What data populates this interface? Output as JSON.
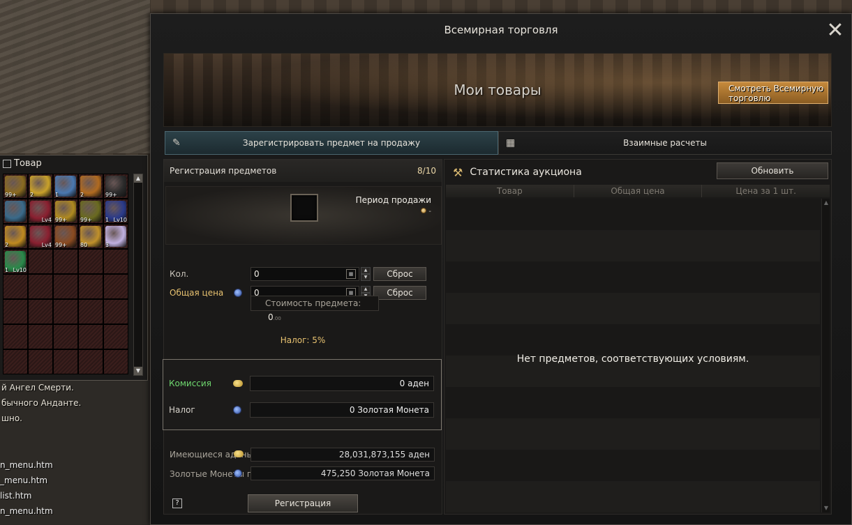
{
  "background": {
    "chat_lines": [
      "й Ангел Смерти.",
      "бычного Анданте.",
      "шно."
    ],
    "file_lines": [
      "n_menu.htm",
      "_menu.htm",
      "list.htm",
      "n_menu.htm"
    ]
  },
  "inventory": {
    "title": "Товар",
    "slots": [
      {
        "qty": "99+",
        "lv": "",
        "color": "#8a6a20"
      },
      {
        "qty": "2",
        "lv": "",
        "color": "#c9a12a"
      },
      {
        "qty": "1",
        "lv": "",
        "color": "#4a78b0"
      },
      {
        "qty": "2",
        "lv": "",
        "color": "#b06a20"
      },
      {
        "qty": "99+",
        "lv": "",
        "color": "#2a2a2a"
      },
      {
        "qty": "",
        "lv": "",
        "color": "#3a6a8a"
      },
      {
        "qty": "",
        "lv": "Lv4",
        "color": "#8a2030"
      },
      {
        "qty": "99+",
        "lv": "",
        "color": "#b08a20"
      },
      {
        "qty": "99+",
        "lv": "",
        "color": "#6a6a20"
      },
      {
        "qty": "1",
        "lv": "Lv10",
        "color": "#2a3a8a"
      },
      {
        "qty": "2",
        "lv": "",
        "color": "#c08a20"
      },
      {
        "qty": "",
        "lv": "Lv4",
        "color": "#8a2030"
      },
      {
        "qty": "99+",
        "lv": "",
        "color": "#8a4a20"
      },
      {
        "qty": "80",
        "lv": "",
        "color": "#c0902a"
      },
      {
        "qty": "3",
        "lv": "",
        "color": "#c0b0e0"
      },
      {
        "qty": "1",
        "lv": "Lv10",
        "color": "#2a8a4a"
      }
    ]
  },
  "window": {
    "title": "Всемирная торговля",
    "close": "✕"
  },
  "banner": {
    "title": "Мои товары",
    "world_btn": "Смотреть Всемирную торговлю"
  },
  "tabs": [
    {
      "label": "Зарегистрировать предмет на продажу",
      "icon": "✎"
    },
    {
      "label": "Взаимные расчеты",
      "icon": "▦"
    }
  ],
  "register": {
    "header": "Регистрация предметов",
    "count": "8/10",
    "period_label": "Период продажи",
    "period_value": "-",
    "qty_label": "Кол.",
    "qty_value": "0",
    "reset": "Сброс",
    "total_label": "Общая цена",
    "total_value": "0",
    "cost_label": "Стоимость предмета:",
    "cost_value": "0",
    "cost_decimals": ".00",
    "tax_note": "Налог: 5%",
    "commission_label": "Комиссия",
    "commission_value": "0 аден",
    "tax_label": "Налог",
    "tax_value": "0 Золотая Монета",
    "adena_label": "Имеющиеся адены",
    "adena_value": "28,031,873,155 аден",
    "gold_label": "Золотые Монеты персонажа",
    "gold_value": "475,250 Золотая Монета",
    "help": "?",
    "submit": "Регистрация"
  },
  "stats": {
    "title": "Статистика аукциона",
    "refresh": "Обновить",
    "columns": [
      "Товар",
      "Общая цена",
      "Цена за 1 шт."
    ],
    "empty": "Нет предметов, соответствующих условиям."
  }
}
